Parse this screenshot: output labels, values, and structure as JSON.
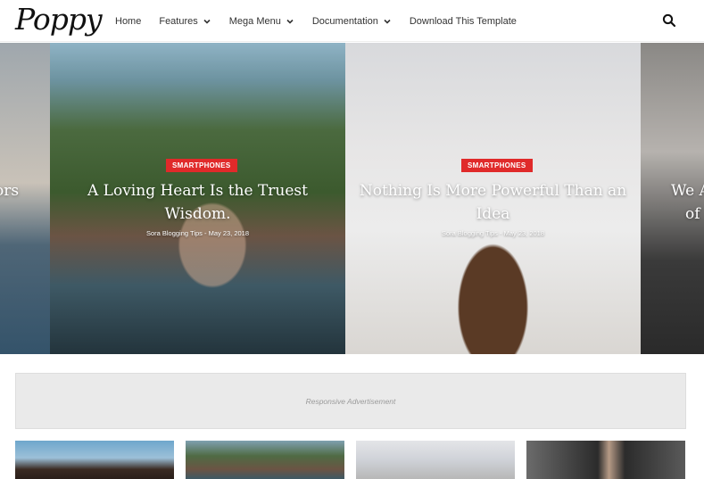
{
  "header": {
    "logo": "Poppy",
    "nav": [
      {
        "label": "Home",
        "dropdown": false
      },
      {
        "label": "Features",
        "dropdown": true
      },
      {
        "label": "Mega Menu",
        "dropdown": true
      },
      {
        "label": "Documentation",
        "dropdown": true
      },
      {
        "label": "Download This Template",
        "dropdown": false
      }
    ],
    "search_icon": "search-icon"
  },
  "slider": {
    "left_partial": "ors",
    "slides": [
      {
        "tag": "SMARTPHONES",
        "title_line1": "A Loving Heart Is the Truest",
        "title_line2": "Wisdom.",
        "meta": "Sora Blogging Tips - May 23, 2018"
      },
      {
        "tag": "SMARTPHONES",
        "title_line1": "Nothing Is More Powerful Than an",
        "title_line2": "Idea",
        "meta": "Sora Blogging Tips - May 23, 2018"
      }
    ],
    "right_partial_line1": "We A",
    "right_partial_line2": "of"
  },
  "ad": {
    "label": "Responsive Advertisement"
  },
  "colors": {
    "accent": "#e02a2a",
    "text": "#333333",
    "ad_bg": "#eaeaea"
  }
}
